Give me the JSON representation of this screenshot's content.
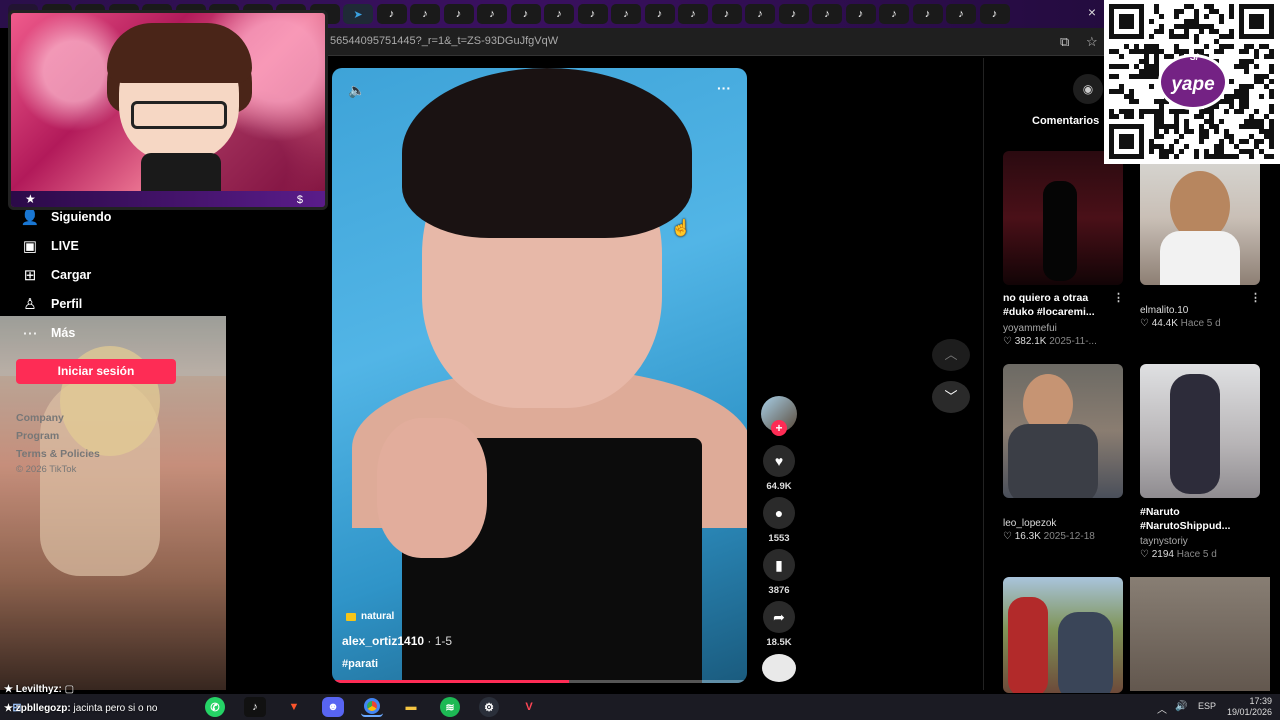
{
  "browser": {
    "url": "56544095751445?_r=1&_t=ZS-93DGuJfgVqW",
    "tab_count_label": "",
    "tab_close": "×"
  },
  "sidebar": {
    "items": [
      {
        "label": "Siguiendo",
        "icon": "following-icon"
      },
      {
        "label": "LIVE",
        "icon": "live-icon"
      },
      {
        "label": "Cargar",
        "icon": "upload-icon"
      },
      {
        "label": "Perfil",
        "icon": "profile-icon"
      },
      {
        "label": "Más",
        "icon": "more-icon"
      }
    ],
    "login_button": "Iniciar sesión",
    "footer_links": [
      "Company",
      "Program",
      "Terms & Policies",
      "© 2026 TikTok"
    ]
  },
  "chat": [
    {
      "user": "★ Levilthyz:",
      "text": ""
    },
    {
      "user": "★ zpbllegozp:",
      "text": "jacinta pero si o no"
    }
  ],
  "video": {
    "tag": "natural",
    "author": "alex_ortiz1410",
    "date": "1-5",
    "hashtag": "#parati",
    "progress": 0.57,
    "likes": "64.9K",
    "comments": "1553",
    "saves": "3876",
    "shares": "18.5K"
  },
  "right_panel": {
    "comments_tab": "Comentarios",
    "tiles": [
      {
        "title": "no quiero a otraa #duko #locaremi...",
        "user": "yoyammefui",
        "views": "382.1K",
        "date": "2025-11-..."
      },
      {
        "title": "",
        "user": "elmalito.10",
        "views": "44.4K",
        "date": "Hace 5 d"
      },
      {
        "title": "",
        "user": "leo_lopezok",
        "views": "16.3K",
        "date": "2025-12-18"
      },
      {
        "title": "#Naruto #NarutoShippud...",
        "user": "taynystoriy",
        "views": "2194",
        "date": "Hace 5 d"
      }
    ]
  },
  "qr": {
    "logo_text": "yape",
    "currency": "S/"
  },
  "taskbar": {
    "lang": "ESP",
    "time": "17:39",
    "date": "19/01/2026"
  },
  "colors": {
    "accent": "#fe2c55",
    "stream_purple": "#5a1c8a",
    "qr_purple": "#742284"
  }
}
